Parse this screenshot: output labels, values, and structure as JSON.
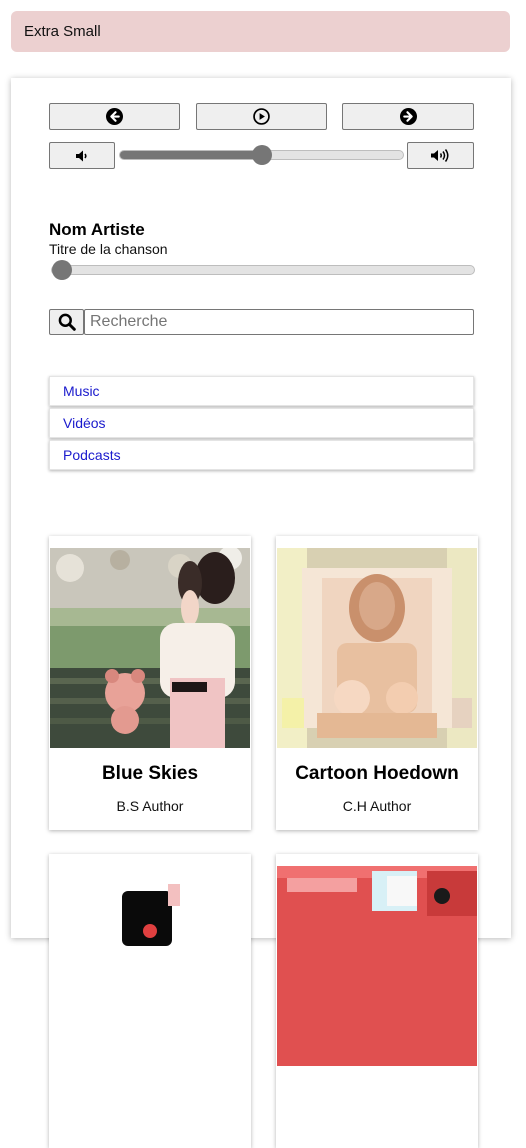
{
  "banner": {
    "label": "Extra Small"
  },
  "player": {
    "prev_icon": "arrow-left-circle-icon",
    "play_icon": "play-circle-icon",
    "next_icon": "arrow-right-circle-icon",
    "volume_down_icon": "volume-down-icon",
    "volume_up_icon": "volume-up-icon",
    "volume_level": 0.5,
    "progress_level": 0.0,
    "artist": "Nom Artiste",
    "song": "Titre de la chanson"
  },
  "search": {
    "placeholder": "Recherche",
    "value": "",
    "icon": "search-icon"
  },
  "nav": {
    "items": [
      {
        "label": "Music"
      },
      {
        "label": "Vidéos"
      },
      {
        "label": "Podcasts"
      }
    ]
  },
  "cards": [
    {
      "title": "Blue Skies",
      "author": "B.S Author"
    },
    {
      "title": "Cartoon Hoedown",
      "author": "C.H Author"
    }
  ],
  "colors": {
    "banner_bg": "#ecd0d0",
    "link": "#1a1acd",
    "slider": "#767676"
  }
}
